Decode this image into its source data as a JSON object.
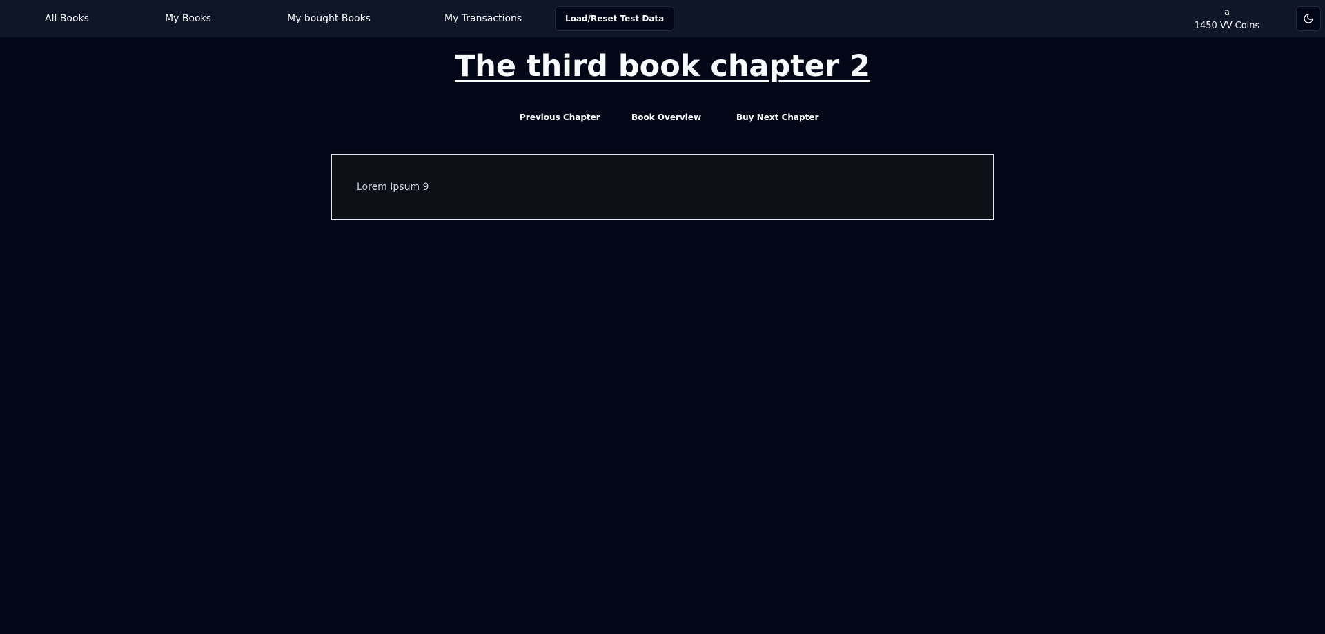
{
  "nav": {
    "all_books": "All Books",
    "my_books": "My Books",
    "my_bought_books": "My bought Books",
    "my_transactions": "My Transactions",
    "load_reset": "Load/Reset Test Data"
  },
  "user": {
    "name": "a",
    "coins": "1450 VV-Coins"
  },
  "theme_toggle_icon": "moon-icon",
  "page": {
    "title": "The third book chapter 2",
    "previous_chapter": "Previous Chapter",
    "book_overview": "Book Overview",
    "buy_next_chapter": "Buy Next Chapter",
    "content": "Lorem Ipsum 9"
  },
  "colors": {
    "background": "#020817",
    "navbar": "#0e1628",
    "content_box": "#0d1017",
    "text": "#f8fafc"
  }
}
